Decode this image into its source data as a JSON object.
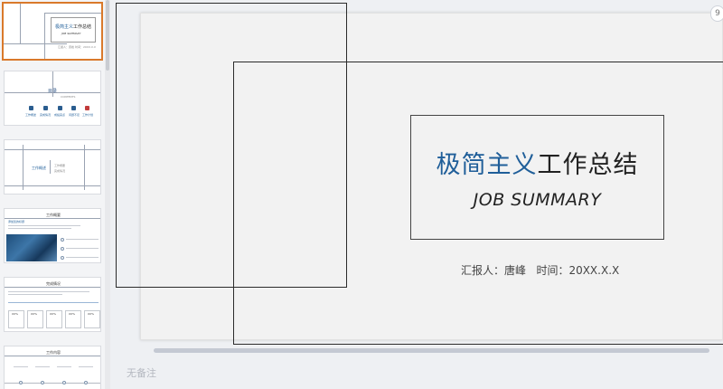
{
  "thumbnails": {
    "slide1": {
      "title_blue": "极简主义",
      "title_dark": "工作总结",
      "subtitle": "JOB SUMMARY",
      "info": "汇报人：唐峰  时间：20XX.X.X"
    },
    "slide2": {
      "title": "目录",
      "subtitle": "CONTENTS",
      "items": [
        "工作概述",
        "完成情况",
        "成绩亮点",
        "问题不足",
        "工作计划"
      ]
    },
    "slide3": {
      "label_left": "工作概述",
      "label_right1": "工作概要",
      "label_right2": "完成情况"
    },
    "slide4": {
      "title": "工作概要",
      "heading": "添加您的标题"
    },
    "slide5": {
      "title": "完成情况",
      "percents": [
        "XX%",
        "XX%",
        "XX%",
        "XX%",
        "XX%"
      ]
    },
    "slide6": {
      "title": "工作内容"
    }
  },
  "slide": {
    "title_blue": "极简主义",
    "title_dark": "工作总结",
    "subtitle": "JOB SUMMARY",
    "reporter": "汇报人：唐峰   时间：20XX.X.X"
  },
  "notes_placeholder": "无备注",
  "corner_label": "9"
}
